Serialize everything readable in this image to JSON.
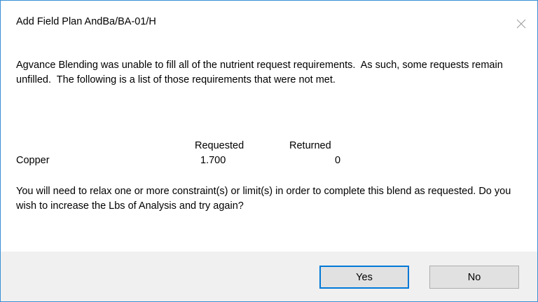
{
  "dialog": {
    "title": "Add Field Plan AndBa/BA-01/H",
    "close_icon": "close-icon",
    "message": "Agvance Blending was unable to fill all of the nutrient request requirements.  As such, some requests remain unfilled.  The following is a list of those requirements that were not met.",
    "table": {
      "headers": {
        "requested": "Requested",
        "returned": "Returned"
      },
      "rows": [
        {
          "nutrient": "Copper",
          "requested": "1.700",
          "returned": "0"
        }
      ]
    },
    "message2": "You will need to relax one or more constraint(s) or limit(s) in order to complete this blend as requested. Do you wish to increase the Lbs of Analysis and try again?",
    "buttons": {
      "yes": "Yes",
      "no": "No"
    },
    "colors": {
      "border": "#3a8fd6",
      "footer_bg": "#f0f0f0",
      "default_button_border": "#0078d7"
    }
  }
}
